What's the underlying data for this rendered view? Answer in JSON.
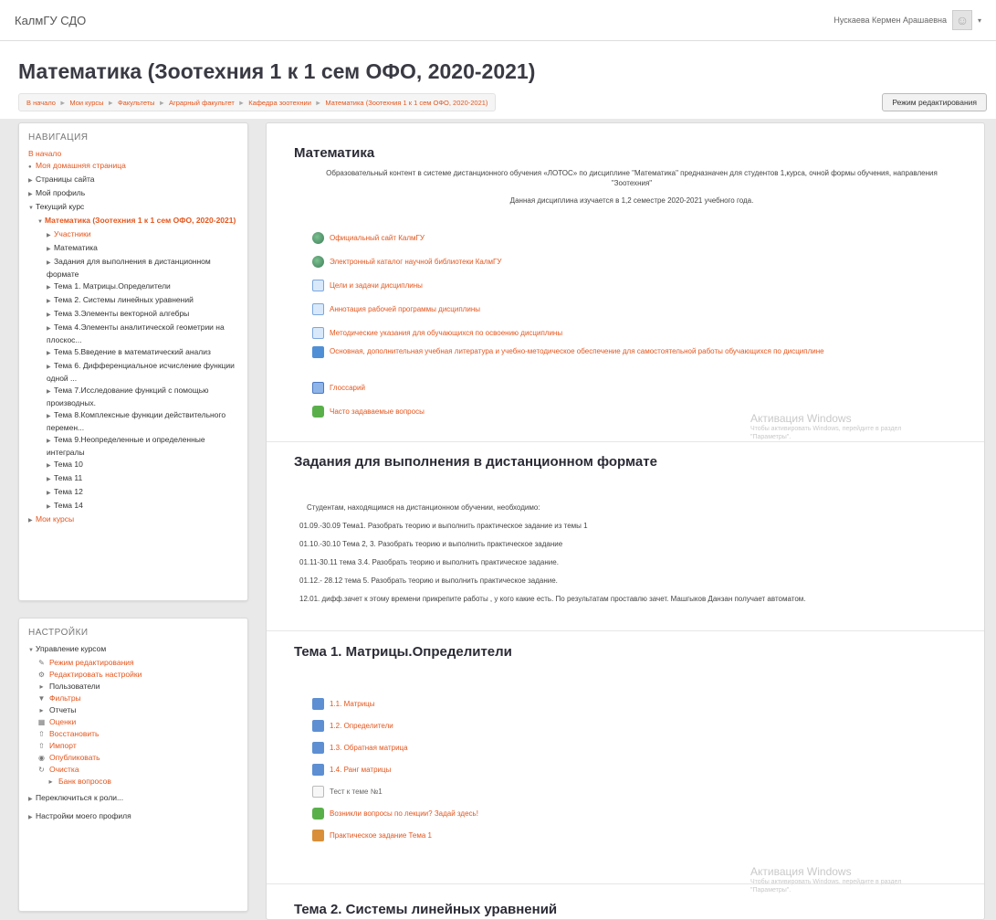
{
  "header": {
    "site_name": "КалмГУ СДО",
    "user_name": "Нускаева Кермен Арашаевна",
    "caret": "▾"
  },
  "page": {
    "title": "Математика (Зоотехния 1 к 1 сем ОФО, 2020-2021)",
    "breadcrumb": [
      "В начало",
      "Мои курсы",
      "Факультеты",
      "Аграрный факультет",
      "Кафедра зоотехнии",
      "Математика (Зоотехния 1 к 1 сем ОФО, 2020-2021)"
    ],
    "breadcrumb_sep": "►",
    "edit_button": "Режим редактирования"
  },
  "navigation": {
    "title": "НАВИГАЦИЯ",
    "home": "В начало",
    "my_home": "Моя домашняя страница",
    "site_pages": "Страницы сайта",
    "my_profile": "Мой профиль",
    "current_course": "Текущий курс",
    "course_name": "Математика (Зоотехния 1 к 1 сем ОФО, 2020-2021)",
    "items": [
      "Участники",
      "Математика",
      "Задания для выполнения в дистанционном формате",
      "Тема 1. Матрицы.Определители",
      "Тема 2. Системы линейных уравнений",
      "Тема 3.Элементы векторной алгебры",
      "Тема 4.Элементы аналитической геометрии на плоскос...",
      "Тема 5.Введение в математический анализ",
      "Тема 6. Дифференциальное исчисление функции одной ...",
      "Тема 7.Исследование функций с помощью производных.",
      "Тема 8.Комплексные функции действительного перемен...",
      "Тема 9.Неопределенные и определенные интегралы",
      "Тема 10",
      "Тема 11",
      "Тема 12",
      "Тема 14"
    ],
    "my_courses": "Мои курсы"
  },
  "settings": {
    "title": "НАСТРОЙКИ",
    "manage": "Управление курсом",
    "items": [
      {
        "label": "Режим редактирования",
        "icon": "pencil-icon",
        "link": true
      },
      {
        "label": "Редактировать настройки",
        "icon": "gear-icon",
        "link": true
      },
      {
        "label": "Пользователи",
        "icon": "triangle-icon",
        "link": false
      },
      {
        "label": "Фильтры",
        "icon": "filter-icon",
        "link": true
      },
      {
        "label": "Отчеты",
        "icon": "triangle-icon",
        "link": false
      },
      {
        "label": "Оценки",
        "icon": "grades-icon",
        "link": true
      },
      {
        "label": "Восстановить",
        "icon": "restore-icon",
        "link": true
      },
      {
        "label": "Импорт",
        "icon": "import-icon",
        "link": true
      },
      {
        "label": "Опубликовать",
        "icon": "publish-icon",
        "link": true
      },
      {
        "label": "Очистка",
        "icon": "reset-icon",
        "link": true
      },
      {
        "label": "Банк вопросов",
        "icon": "triangle-icon",
        "link": true
      }
    ],
    "switch_role": "Переключиться к роли...",
    "profile_settings": "Настройки моего профиля"
  },
  "sections": {
    "intro": {
      "title": "Математика",
      "desc1": "Образовательный контент в системе дистанционного обучения «ЛОТОС» по дисциплине \"Математика\" предназначен для студентов 1,курса, очной формы обучения, направления \"Зоотехния\"",
      "desc2": "Данная дисциплина изучается в 1,2 семестре 2020-2021 учебного года.",
      "activities": [
        {
          "label": "Официальный сайт КалмГУ",
          "icon": "globe-icon"
        },
        {
          "label": "Электронный каталог научной библиотеки КалмГУ",
          "icon": "globe-icon"
        },
        {
          "label": "Цели и задачи дисциплины",
          "icon": "page-icon"
        },
        {
          "label": "Аннотация рабочей программы дисциплины",
          "icon": "page-icon"
        },
        {
          "label": "Методические указания для обучающихся по освоению дисциплины",
          "icon": "page-icon"
        },
        {
          "label": "Основная, дополнительная учебная литература и учебно-методическое обеспечение для самостоятельной работы обучающихся по дисциплине",
          "icon": "folder-icon"
        },
        {
          "label": "Глоссарий",
          "icon": "glossary-icon"
        },
        {
          "label": "Часто задаваемые вопросы",
          "icon": "forum-icon"
        }
      ]
    },
    "tasks": {
      "title": "Задания для выполнения в дистанционном формате",
      "lines": [
        "Студентам, находящимся на дистанционном обучении, необходимо:",
        "01.09.-30.09 Тема1. Разобрать теорию и выполнить практическое задание из темы 1",
        "01.10.-30.10 Тема 2, 3. Разобрать теорию и выполнить практическое задание",
        "01.11-30.11 тема 3.4. Разобрать теорию и выполнить практическое задание.",
        "01.12.- 28.12 тема 5. Разобрать теорию и выполнить практическое задание.",
        "12.01.  дифф.зачет   к этому времени прикрепите работы , у кого какие есть. По результатам проставлю зачет. Машгыков Данзан получает автоматом."
      ]
    },
    "topic1": {
      "title": "Тема 1. Матрицы.Определители",
      "activities": [
        {
          "label": "1.1. Матрицы",
          "icon": "book-icon"
        },
        {
          "label": "1.2. Определители",
          "icon": "book-icon"
        },
        {
          "label": "1.3. Обратная матрица",
          "icon": "book-icon"
        },
        {
          "label": "1.4. Ранг матрицы",
          "icon": "book-icon"
        },
        {
          "label": "Тест к теме №1",
          "icon": "quiz-icon"
        },
        {
          "label": "Возникли вопросы по лекции? Задай здесь!",
          "icon": "forum-icon"
        },
        {
          "label": "Практическое задание Тема 1",
          "icon": "assignment-icon"
        }
      ]
    },
    "topic2": {
      "title": "Тема 2. Системы линейных уравнений"
    }
  },
  "watermark": {
    "title": "Активация Windows",
    "subtitle": "Чтобы активировать Windows, перейдите в раздел \"Параметры\"."
  },
  "colors": {
    "link": "#e4561d",
    "title": "#3a3a44"
  }
}
